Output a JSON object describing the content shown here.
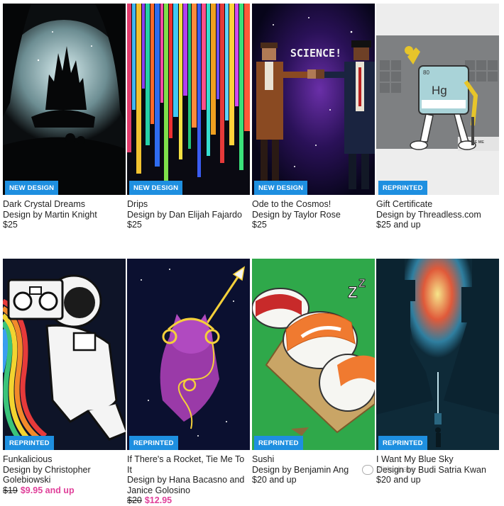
{
  "products": [
    {
      "title": "Dark Crystal Dreams",
      "designer": "Design by Martin Knight",
      "price": "$25",
      "badge": "NEW DESIGN"
    },
    {
      "title": "Drips",
      "designer": "Design by Dan Elijah Fajardo",
      "price": "$25",
      "badge": "NEW DESIGN"
    },
    {
      "title": "Ode to the Cosmos!",
      "designer": "Design by Taylor Rose",
      "price": "$25",
      "badge": "NEW DESIGN"
    },
    {
      "title": "Gift Certificate",
      "designer": "Design by Threadless.com",
      "price": "$25 and up",
      "badge": "REPRINTED"
    },
    {
      "title": "Funkalicious",
      "designer_line1": "Design by Christopher",
      "designer_line2": "Golebiowski",
      "price_old": "$19",
      "price_sale": "$9.95 and up",
      "badge": "REPRINTED"
    },
    {
      "title": "If There's a Rocket, Tie Me To It",
      "designer_line1": "Design by Hana Bacasno and",
      "designer_line2": "Janice Golosino",
      "price_old": "$20",
      "price_sale": "$12.95",
      "badge": "REPRINTED"
    },
    {
      "title": "Sushi",
      "designer": "Design by Benjamin Ang",
      "price": "$20 and up",
      "badge": "REPRINTED"
    },
    {
      "title": "I Want My Blue Sky",
      "designer": "Design by Budi Satria Kwan",
      "price": "$20 and up",
      "badge": "REPRINTED"
    }
  ],
  "artwork_text": {
    "science": "SCIENCE!",
    "hg": "Hg",
    "element_number": "80",
    "freddie": "FREDDIE ME"
  },
  "watermark": "slideshare",
  "colors": {
    "badge": "#1e8fe0",
    "sale": "#e0409a"
  }
}
